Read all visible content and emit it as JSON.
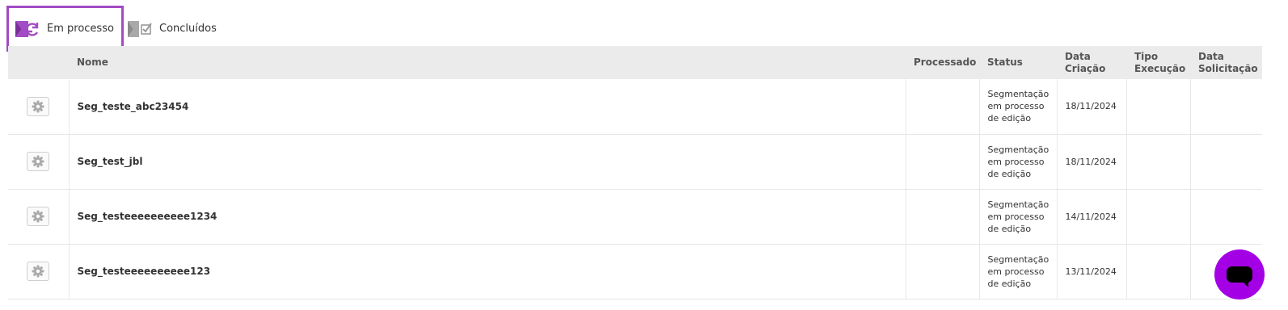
{
  "tabs": [
    {
      "label": "Em processo",
      "icon": "send-sync-icon",
      "active": true
    },
    {
      "label": "Concluídos",
      "icon": "send-check-icon",
      "active": false
    }
  ],
  "table": {
    "headers": {
      "name": "Nome",
      "processed": "Processado",
      "status": "Status",
      "created_date_1": "Data",
      "created_date_2": "Criação",
      "exec_type_1": "Tipo",
      "exec_type_2": "Execução",
      "request_date_1": "Data",
      "request_date_2": "Solicitação"
    },
    "rows": [
      {
        "name": "Seg_teste_abc23454",
        "processed": "",
        "status": [
          "Segmentação",
          "em processo",
          "de edição"
        ],
        "created": "18/11/2024",
        "exec_type": "",
        "requested": ""
      },
      {
        "name": "Seg_test_jbl",
        "processed": "",
        "status": [
          "Segmentação",
          "em processo",
          "de edição"
        ],
        "created": "18/11/2024",
        "exec_type": "",
        "requested": ""
      },
      {
        "name": "Seg_testeeeeeeeeee1234",
        "processed": "",
        "status": [
          "Segmentação",
          "em processo",
          "de edição"
        ],
        "created": "14/11/2024",
        "exec_type": "",
        "requested": ""
      },
      {
        "name": "Seg_testeeeeeeeeee123",
        "processed": "",
        "status": [
          "Segmentação",
          "em processo",
          "de edição"
        ],
        "created": "13/11/2024",
        "exec_type": "",
        "requested": ""
      }
    ]
  },
  "colors": {
    "accent": "#a24bc4",
    "chat": "#a400e6",
    "header_bg": "#ebebeb"
  }
}
